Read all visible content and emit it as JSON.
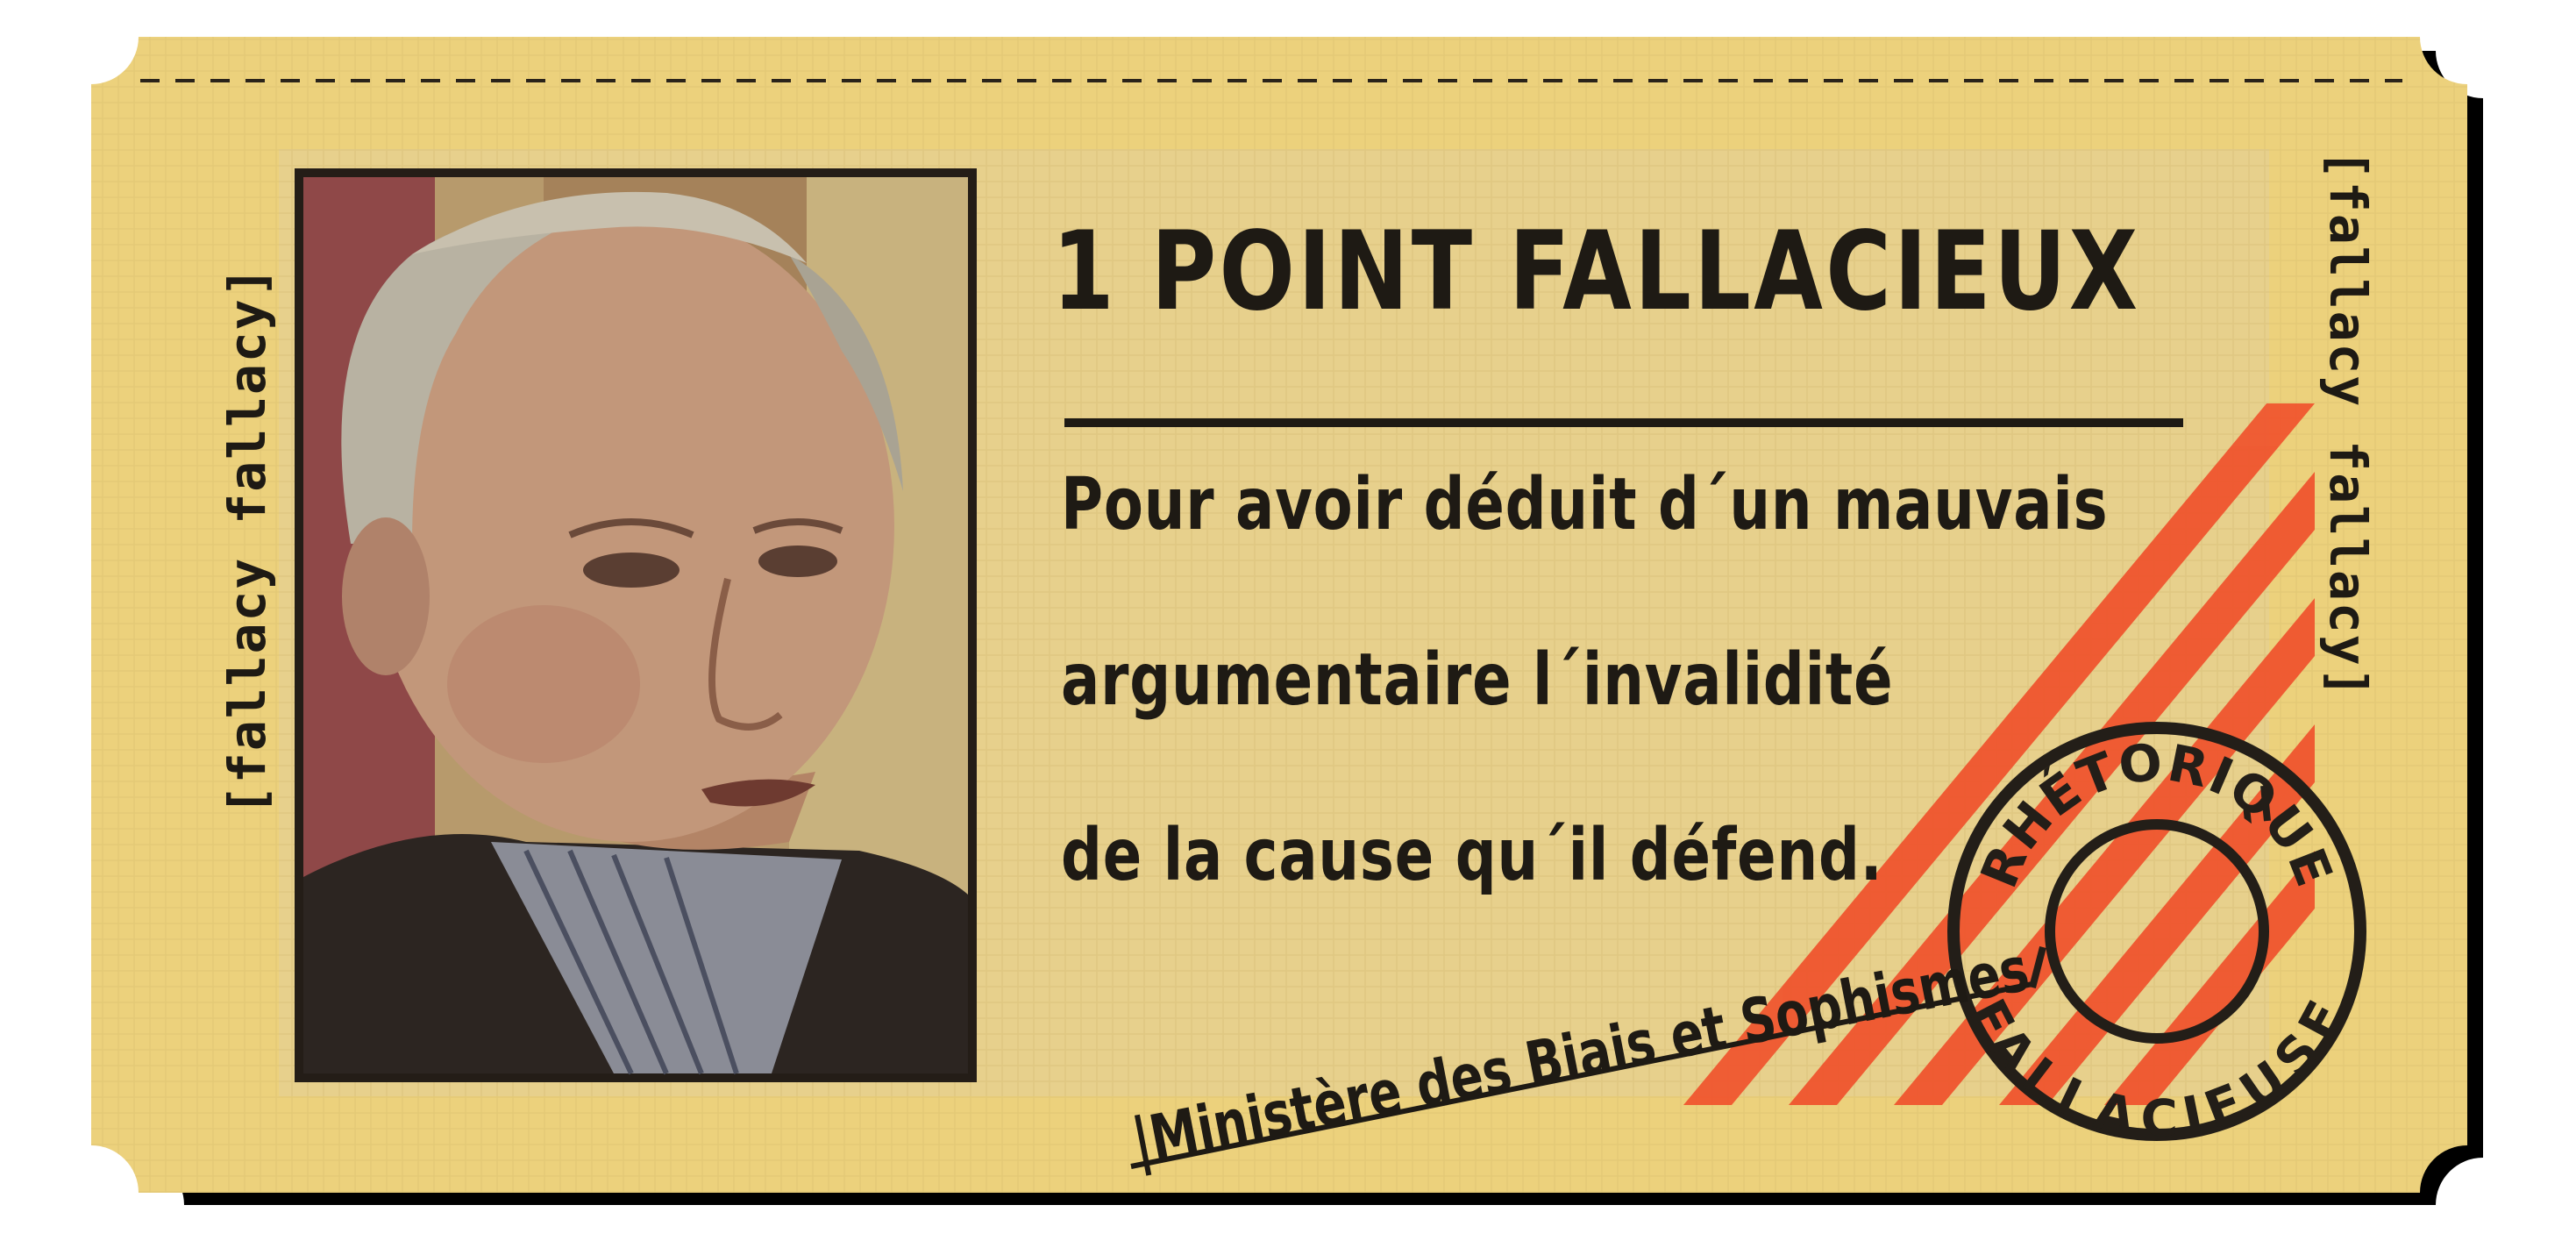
{
  "ticket": {
    "title": "1 POINT FALLACIEUX",
    "message_lines": [
      "Pour avoir déduit d´un mauvais",
      "argumentaire l´invalidité",
      "de la cause qu´il défend."
    ],
    "signature": "|Ministère des Biais et Sophismes",
    "side_left": "[fallacy fallacy]",
    "side_right": "[fallacy fallacy]"
  },
  "stamp": {
    "top_text": "RHÉTORIQUE",
    "bottom_text": "FALLACIEUSE"
  },
  "portrait": {
    "icon": "man-portrait-photo"
  },
  "colors": {
    "ticket": "#ecd17c",
    "ticket_inner": "#e8d08e",
    "ink": "#1e1a14",
    "stripes": "#f0522c",
    "shadow": "#000000"
  }
}
